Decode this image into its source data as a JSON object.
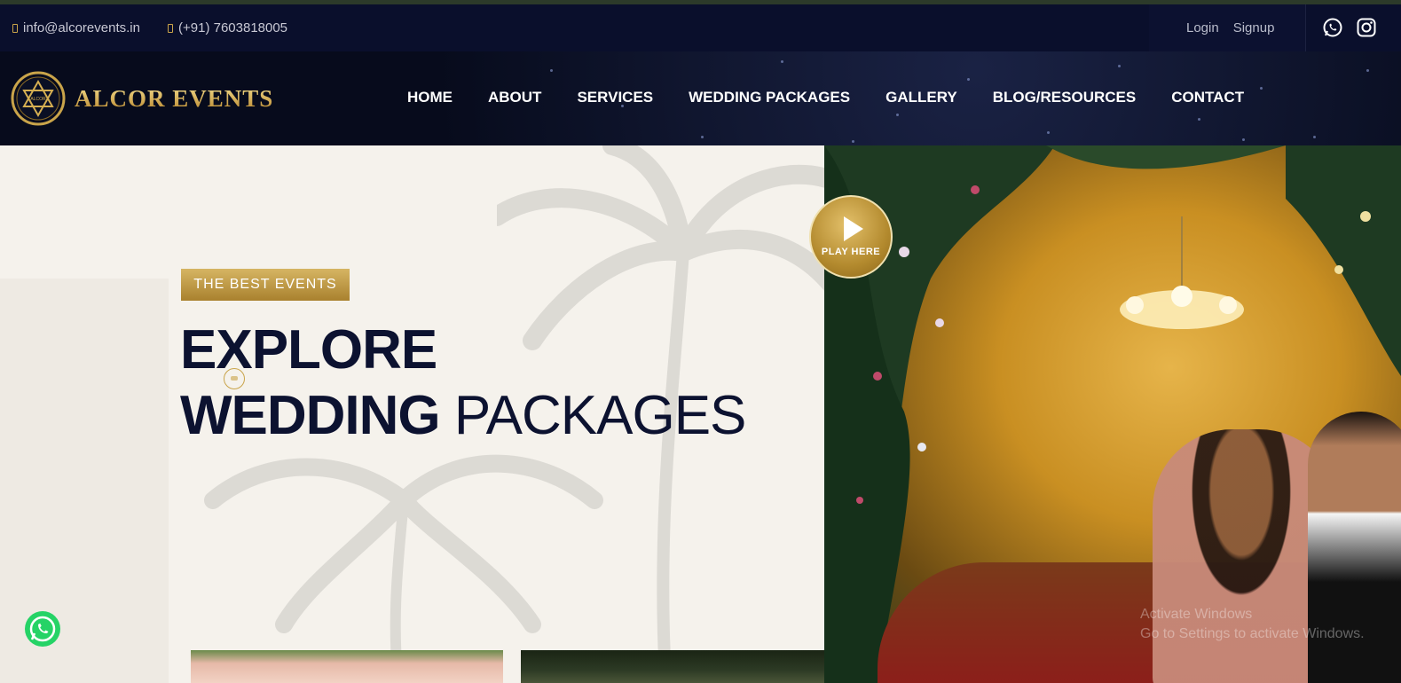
{
  "topbar": {
    "email": "info@alcorevents.in",
    "phone": "(+91) 7603818005",
    "login": "Login",
    "signup": "Signup",
    "social_icons": [
      "whatsapp-icon",
      "instagram-icon"
    ]
  },
  "brand": {
    "name": "ALCOR EVENTS",
    "logo_text": "ALCOR",
    "accent_gold": "#c9a44a",
    "navy": "#0c1230"
  },
  "nav": {
    "items": [
      "HOME",
      "ABOUT",
      "SERVICES",
      "WEDDING PACKAGES",
      "GALLERY",
      "BLOG/RESOURCES",
      "CONTACT"
    ]
  },
  "hero": {
    "badge": "THE BEST EVENTS",
    "title_line1": "EXPLORE",
    "title_line2_bold": "WEDDING",
    "title_line2_light": "PACKAGES",
    "play_label": "PLAY HERE"
  },
  "overlay": {
    "windows_line1": "Activate Windows",
    "windows_line2": "Go to Settings to activate Windows."
  }
}
